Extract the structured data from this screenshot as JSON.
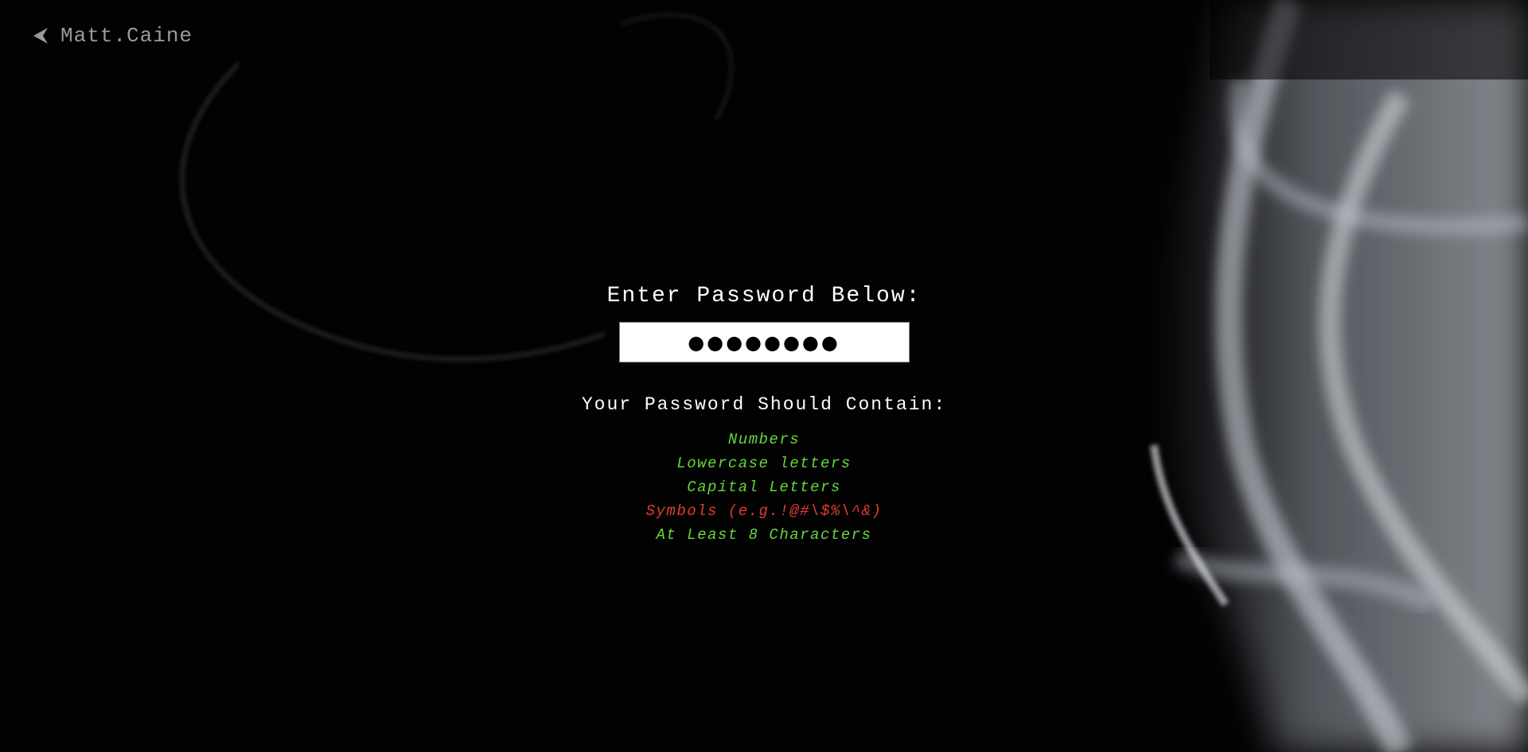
{
  "header": {
    "back_label": "Matt.Caine"
  },
  "form": {
    "prompt": "Enter Password Below:",
    "password_value": "●●●●●●●●"
  },
  "requirements": {
    "title": "Your Password Should Contain:",
    "items": [
      {
        "label": "Numbers",
        "met": true
      },
      {
        "label": "Lowercase letters",
        "met": true
      },
      {
        "label": "Capital Letters",
        "met": true
      },
      {
        "label": "Symbols (e.g.!@#\\$%\\^&)",
        "met": false
      },
      {
        "label": "At Least 8 Characters",
        "met": true
      }
    ]
  },
  "colors": {
    "met": "#66d63a",
    "unmet": "#e23b2e",
    "background": "#000000",
    "text": "#ffffff",
    "back_link": "#9a9a9a"
  },
  "icons": {
    "back": "chevron-left-icon"
  }
}
